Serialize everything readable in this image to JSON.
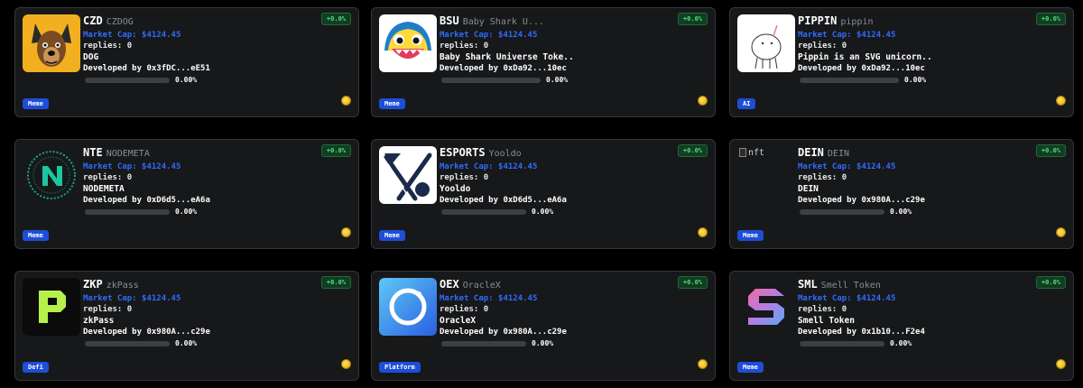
{
  "colors": {
    "card_bg": "#17181a",
    "accent_blue": "#2f6bff",
    "tag_blue": "#1d4ed8",
    "positive_green": "#4ade80"
  },
  "cards": [
    {
      "symbol": "CZD",
      "name": "CZDOG",
      "market_cap": "Market Cap: $4124.45",
      "replies": "replies: 0",
      "description": "DOG",
      "developer": "Developed by 0x3fDC...eE51",
      "progress": "0.00%",
      "progress_value": 0,
      "change": "+0.0%",
      "tag": "Meme",
      "logo": "dog-logo-icon"
    },
    {
      "symbol": "BSU",
      "name": "Baby Shark U...",
      "market_cap": "Market Cap: $4124.45",
      "replies": "replies: 0",
      "description": "Baby Shark Universe Toke..",
      "developer": "Developed by 0xDa92...10ec",
      "progress": "0.00%",
      "progress_value": 0,
      "change": "+0.0%",
      "tag": "Meme",
      "logo": "baby-shark-logo-icon"
    },
    {
      "symbol": "PIPPIN",
      "name": "pippin",
      "market_cap": "Market Cap: $4124.45",
      "replies": "replies: 0",
      "description": "Pippin is an SVG unicorn..",
      "developer": "Developed by 0xDa92...10ec",
      "progress": "0.00%",
      "progress_value": 0,
      "change": "+0.0%",
      "tag": "AI",
      "logo": "unicorn-logo-icon"
    },
    {
      "symbol": "NTE",
      "name": "NODEMETA",
      "market_cap": "Market Cap: $4124.45",
      "replies": "replies: 0",
      "description": "NODEMETA",
      "developer": "Developed by 0xD6d5...eA6a",
      "progress": "0.00%",
      "progress_value": 0,
      "change": "+0.0%",
      "tag": "Meme",
      "logo": "nodemeta-logo-icon"
    },
    {
      "symbol": "ESPORTS",
      "name": "Yooldo",
      "market_cap": "Market Cap: $4124.45",
      "replies": "replies: 0",
      "description": "Yooldo",
      "developer": "Developed by 0xD6d5...eA6a",
      "progress": "0.00%",
      "progress_value": 0,
      "change": "+0.0%",
      "tag": "Meme",
      "logo": "yooldo-logo-icon"
    },
    {
      "symbol": "DEIN",
      "name": "DEIN",
      "market_cap": "Market Cap: $4124.45",
      "replies": "replies: 0",
      "description": "DEIN",
      "developer": "Developed by 0x980A...c29e",
      "progress": "0.00%",
      "progress_value": 0,
      "change": "+0.0%",
      "tag": "Meme",
      "logo": "broken-image-icon",
      "logo_alt": "nft"
    },
    {
      "symbol": "ZKP",
      "name": "zkPass",
      "market_cap": "Market Cap: $4124.45",
      "replies": "replies: 0",
      "description": "zkPass",
      "developer": "Developed by 0x980A...c29e",
      "progress": "0.00%",
      "progress_value": 0,
      "change": "+0.0%",
      "tag": "Defi",
      "logo": "zkpass-logo-icon"
    },
    {
      "symbol": "OEX",
      "name": "OracleX",
      "market_cap": "Market Cap: $4124.45",
      "replies": "replies: 0",
      "description": "OracleX",
      "developer": "Developed by 0x980A...c29e",
      "progress": "0.00%",
      "progress_value": 0,
      "change": "+0.0%",
      "tag": "Platform",
      "logo": "oraclex-logo-icon"
    },
    {
      "symbol": "SML",
      "name": "Smell Token",
      "market_cap": "Market Cap: $4124.45",
      "replies": "replies: 0",
      "description": "Smell Token",
      "developer": "Developed by 0x1b10...F2e4",
      "progress": "0.00%",
      "progress_value": 0,
      "change": "+0.0%",
      "tag": "Meme",
      "logo": "smell-logo-icon"
    }
  ]
}
